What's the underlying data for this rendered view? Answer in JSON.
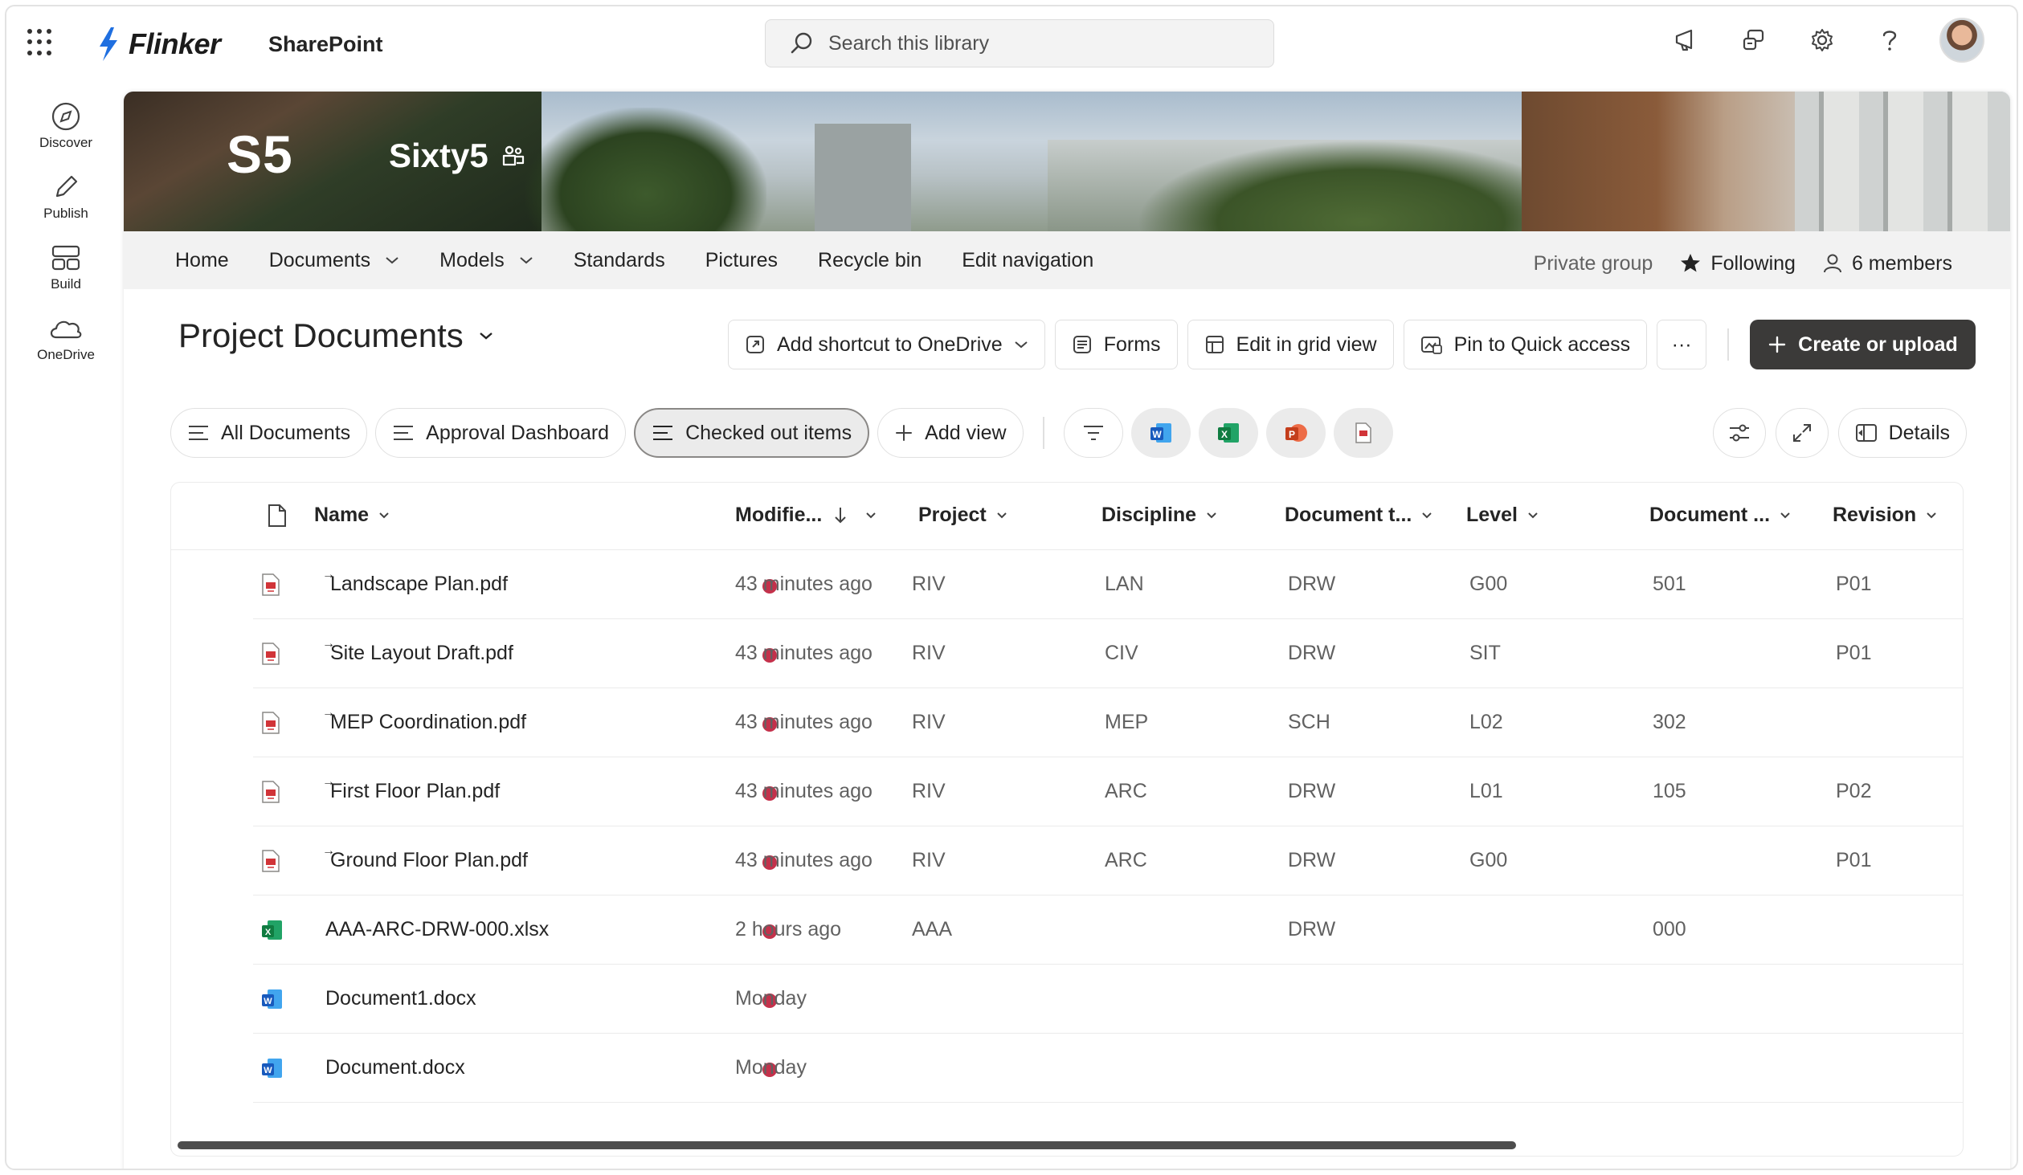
{
  "topbar": {
    "brand": "Flinker",
    "app": "SharePoint",
    "search_placeholder": "Search this library"
  },
  "rail": {
    "items": [
      {
        "label": "Discover",
        "icon": "compass-icon"
      },
      {
        "label": "Publish",
        "icon": "pen-icon"
      },
      {
        "label": "Build",
        "icon": "layout-icon"
      },
      {
        "label": "OneDrive",
        "icon": "cloud-icon"
      }
    ]
  },
  "site": {
    "logo": "S5",
    "title": "Sixty5"
  },
  "sitenav": {
    "links": [
      "Home",
      "Documents",
      "Models",
      "Standards",
      "Pictures",
      "Recycle bin",
      "Edit navigation"
    ],
    "privacy": "Private group",
    "following": "Following",
    "members": "6 members"
  },
  "library": {
    "title": "Project Documents"
  },
  "commands": {
    "shortcut": "Add shortcut to OneDrive",
    "forms": "Forms",
    "grid": "Edit in grid view",
    "pin": "Pin to Quick access",
    "more": "···",
    "create": "Create or upload"
  },
  "views": {
    "all": "All Documents",
    "approval": "Approval Dashboard",
    "checked": "Checked out items",
    "add": "Add view",
    "details": "Details"
  },
  "columns": {
    "name": "Name",
    "modified": "Modifie...",
    "project": "Project",
    "discipline": "Discipline",
    "doctype": "Document t...",
    "level": "Level",
    "docnum": "Document ...",
    "revision": "Revision"
  },
  "rows": [
    {
      "name": "Landscape Plan.pdf",
      "type": "pdf",
      "modified": "43 minutes ago",
      "project": "RIV",
      "discipline": "LAN",
      "doctype": "DRW",
      "level": "G00",
      "docnum": "501",
      "revision": "P01"
    },
    {
      "name": "Site Layout Draft.pdf",
      "type": "pdf",
      "modified": "43 minutes ago",
      "project": "RIV",
      "discipline": "CIV",
      "doctype": "DRW",
      "level": "SIT",
      "docnum": "",
      "revision": "P01"
    },
    {
      "name": "MEP Coordination.pdf",
      "type": "pdf",
      "modified": "43 minutes ago",
      "project": "RIV",
      "discipline": "MEP",
      "doctype": "SCH",
      "level": "L02",
      "docnum": "302",
      "revision": ""
    },
    {
      "name": "First Floor Plan.pdf",
      "type": "pdf",
      "modified": "43 minutes ago",
      "project": "RIV",
      "discipline": "ARC",
      "doctype": "DRW",
      "level": "L01",
      "docnum": "105",
      "revision": "P02"
    },
    {
      "name": "Ground Floor Plan.pdf",
      "type": "pdf",
      "modified": "43 minutes ago",
      "project": "RIV",
      "discipline": "ARC",
      "doctype": "DRW",
      "level": "G00",
      "docnum": "",
      "revision": "P01"
    },
    {
      "name": "AAA-ARC-DRW-000.xlsx",
      "type": "xlsx",
      "modified": "2 hours ago",
      "project": "AAA",
      "discipline": "",
      "doctype": "DRW",
      "level": "",
      "docnum": "000",
      "revision": ""
    },
    {
      "name": "Document1.docx",
      "type": "docx",
      "modified": "Monday",
      "project": "",
      "discipline": "",
      "doctype": "",
      "level": "",
      "docnum": "",
      "revision": ""
    },
    {
      "name": "Document.docx",
      "type": "docx",
      "modified": "Monday",
      "project": "",
      "discipline": "",
      "doctype": "",
      "level": "",
      "docnum": "",
      "revision": ""
    }
  ],
  "colors": {
    "accent_dark": "#3b3a39",
    "checkout_red": "#c4314b",
    "word_blue": "#185abd",
    "excel_green": "#107c41",
    "ppt_red": "#c43e1c",
    "pdf_red": "#d13438"
  }
}
